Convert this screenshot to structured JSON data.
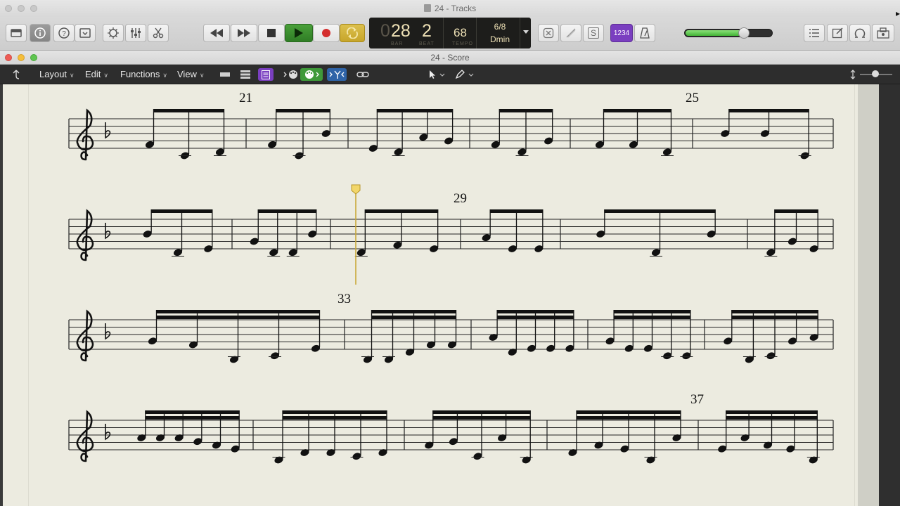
{
  "app": {
    "window_title": "24 - Tracks",
    "cursor_glyph": "▸"
  },
  "toolbar": {
    "library_icon": "library-icon",
    "inspector_icon": "info-icon",
    "quick_help_icon": "help-icon",
    "toolbar_toggle_icon": "toolbar-icon",
    "smart_controls_icon": "smart-controls-icon",
    "mixer_icon": "mixer-icon",
    "editors_icon": "scissors-icon",
    "rewind_icon": "rewind-icon",
    "forward_icon": "fast-forward-icon",
    "stop_icon": "stop-icon",
    "play_icon": "play-icon",
    "record_icon": "record-icon",
    "cycle_icon": "cycle-icon",
    "replace_icon": "replace-icon",
    "tuner_icon": "tuner-icon",
    "solo_label": "S",
    "count_in_label": "1234",
    "metronome_icon": "metronome-icon",
    "list_editors_icon": "list-icon",
    "notepad_icon": "notepad-icon",
    "loops_icon": "loops-icon",
    "browsers_icon": "browser-icon",
    "accent_purple": "#7a3fc0",
    "play_green": "#3a8a2c",
    "record_red": "#d42e2e",
    "cycle_yellow": "#e6b022"
  },
  "lcd": {
    "bar_prefix": "0",
    "bar": "28",
    "beat": "2",
    "bar_label": "BAR",
    "beat_label": "BEAT",
    "tempo": "68",
    "tempo_label": "TEMPO",
    "signature": "6/8",
    "key": "Dmin"
  },
  "master_volume": {
    "level": 0.68
  },
  "score_window": {
    "title": "24 - Score",
    "menus": [
      "Layout",
      "Edit",
      "Functions",
      "View"
    ],
    "up_arrow_icon": "parent-level-icon",
    "link_icon": "link-icon",
    "pointer_tool_icon": "pointer-tool-icon",
    "pencil_tool_icon": "pencil-tool-icon",
    "zoom_icon": "vertical-zoom-icon"
  },
  "score": {
    "clef": "treble",
    "key_signature": "1 flat (Bb)",
    "measure_numbers": [
      "21",
      "25",
      "29",
      "33",
      "37"
    ],
    "playhead_bar": "28"
  }
}
